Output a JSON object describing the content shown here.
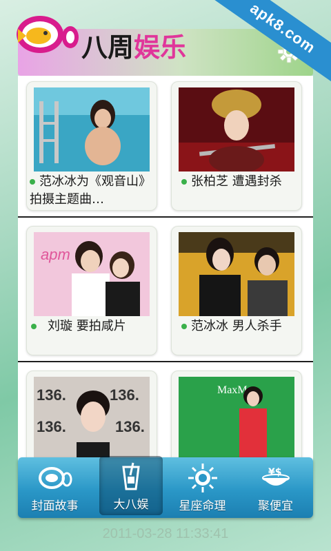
{
  "watermark": "apk8.com",
  "header": {
    "title_part1": "八周",
    "title_part2": "娱乐",
    "accent_color": "#e0369a",
    "settings_icon": "gear-icon"
  },
  "cards": [
    {
      "caption": "范冰冰为《观音山》拍摄主题曲…"
    },
    {
      "caption": "张柏芝 遭遇封杀"
    },
    {
      "caption": "刘璇 要拍咸片"
    },
    {
      "caption": "范冰冰 男人杀手"
    },
    {
      "caption": ""
    },
    {
      "caption": ""
    }
  ],
  "tabs": [
    {
      "label": "封面故事",
      "icon": "fish-logo-icon"
    },
    {
      "label": "大八娱",
      "icon": "drink-cup-icon"
    },
    {
      "label": "星座命理",
      "icon": "sun-star-icon"
    },
    {
      "label": "聚便宜",
      "icon": "money-bowl-icon"
    }
  ],
  "active_tab": "大八娱",
  "timestamp": "2011-03-28 11:33:41"
}
